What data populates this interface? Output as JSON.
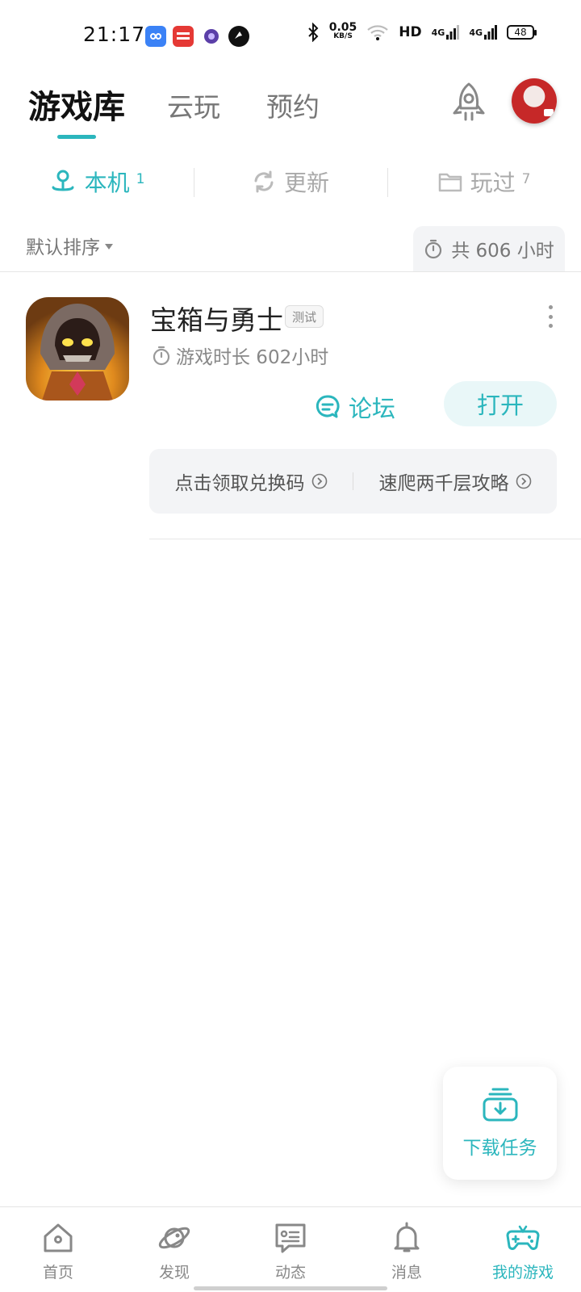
{
  "status_bar": {
    "time": "21:17",
    "net_speed_value": "0.05",
    "net_speed_unit": "KB/S",
    "hd_label": "HD",
    "signal1_label": "4G",
    "signal2_label": "4G",
    "battery_level": "48",
    "notification_icons": [
      "infinity-app-icon",
      "toutiao-app-icon",
      "purple-app-icon",
      "dark-app-icon"
    ]
  },
  "header": {
    "tabs": [
      {
        "label": "游戏库",
        "active": true
      },
      {
        "label": "云玩",
        "active": false
      },
      {
        "label": "预约",
        "active": false
      }
    ]
  },
  "segments": [
    {
      "label": "本机",
      "count": "1",
      "icon": "local-device-icon",
      "active": true
    },
    {
      "label": "更新",
      "count": "",
      "icon": "refresh-icon",
      "active": false
    },
    {
      "label": "玩过",
      "count": "7",
      "icon": "folder-icon",
      "active": false
    }
  ],
  "sort": {
    "label": "默认排序",
    "total_playtime": "共 606 小时"
  },
  "games": [
    {
      "title": "宝箱与勇士",
      "badge": "测试",
      "playtime": "游戏时长 602小时",
      "forum_label": "论坛",
      "open_label": "打开",
      "links": [
        "点击领取兑换码",
        "速爬两千层攻略"
      ]
    }
  ],
  "download_fab": {
    "label": "下载任务"
  },
  "bottom_nav": [
    {
      "label": "首页",
      "icon": "home-icon",
      "active": false
    },
    {
      "label": "发现",
      "icon": "planet-icon",
      "active": false
    },
    {
      "label": "动态",
      "icon": "feed-icon",
      "active": false
    },
    {
      "label": "消息",
      "icon": "bell-icon",
      "active": false
    },
    {
      "label": "我的游戏",
      "icon": "gamepad-icon",
      "active": true
    }
  ],
  "colors": {
    "accent": "#2bb6bd",
    "muted": "#888888",
    "panel": "#f3f4f6"
  }
}
